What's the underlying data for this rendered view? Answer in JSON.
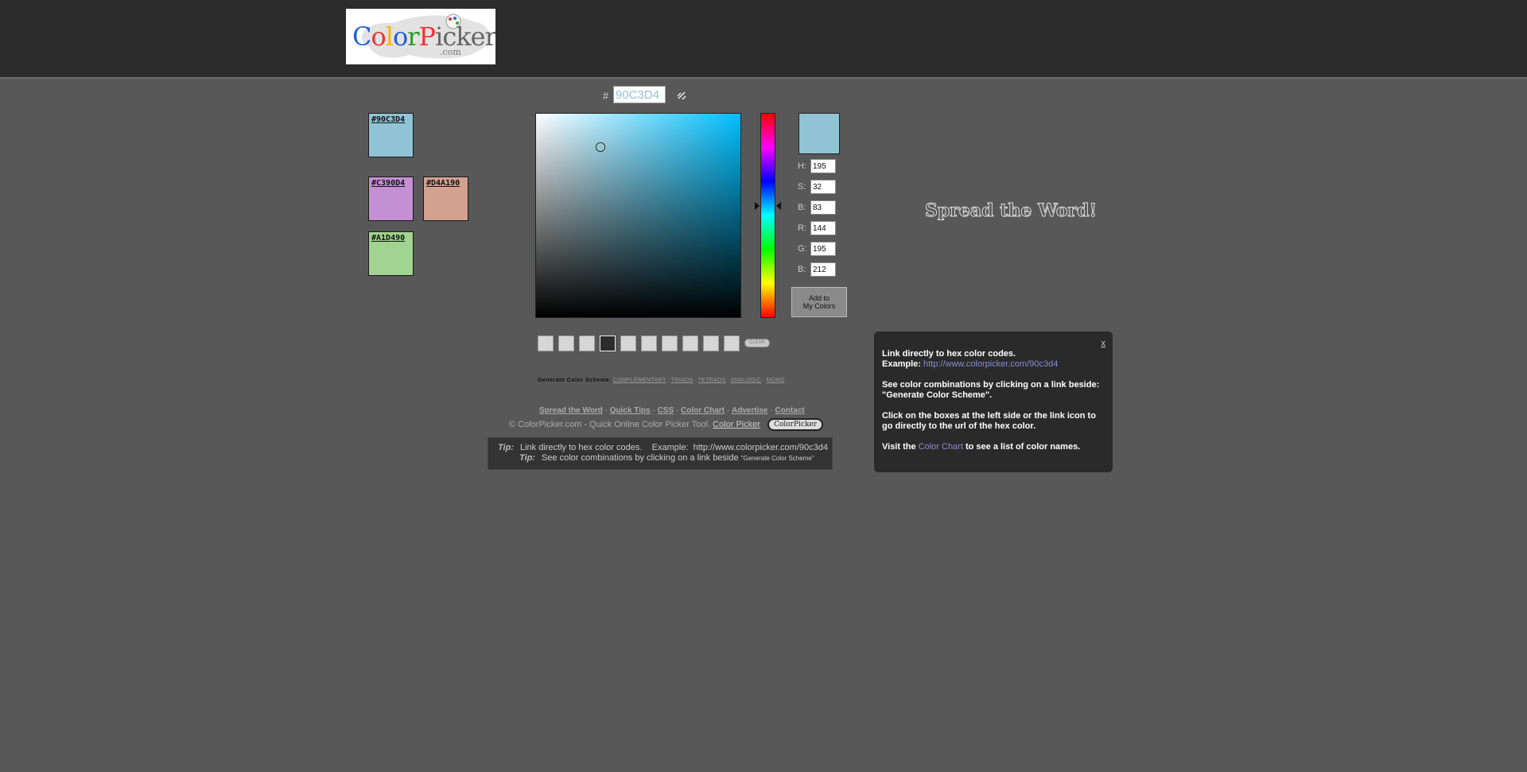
{
  "logo": {
    "text": "ColorPicker",
    "sub": ".com"
  },
  "hex_input": {
    "hash": "#",
    "value": "90C3D4"
  },
  "saved_colors": [
    {
      "hex": "#90C3D4",
      "color": "#90c3d4"
    },
    {
      "hex": "#C390D4",
      "color": "#c390d4"
    },
    {
      "hex": "#D4A190",
      "color": "#d4a190"
    },
    {
      "hex": "#A1D490",
      "color": "#a1d490"
    }
  ],
  "current_color": "#90c3d4",
  "fields": {
    "h": {
      "label": "H:",
      "value": "195"
    },
    "s": {
      "label": "S:",
      "value": "32"
    },
    "b": {
      "label": "B:",
      "value": "83"
    },
    "r": {
      "label": "R:",
      "value": "144"
    },
    "g": {
      "label": "G:",
      "value": "195"
    },
    "b2": {
      "label": "B:",
      "value": "212"
    }
  },
  "add_button": {
    "line1": "Add to",
    "line2": "My Colors"
  },
  "clear_label": "CLEAR",
  "scheme": {
    "label": "Generate Color Scheme:",
    "links": [
      "COMPLEMENTARY",
      "TRIADS",
      "TETRADS",
      "ANALOGIC",
      "MONO"
    ]
  },
  "footer": {
    "links": [
      "Spread the Word",
      "Quick Tips",
      "CSS",
      "Color Chart",
      "Advertise",
      "Contact"
    ],
    "copyright": "© ColorPicker.com - Quick Online Color Picker Tool.",
    "copyright_link": "Color Picker",
    "badge": "ColorPicker"
  },
  "tips": {
    "label": "Tip:",
    "tip1": "Link directly to hex color codes.    Example:  http://www.colorpicker.com/90c3d4",
    "tip2": "See color combinations by clicking on a link beside",
    "tip2_small": "\"Generate Color Scheme\""
  },
  "spread": "Spread the Word!",
  "info_panel": {
    "close": "x",
    "p1_title": "Link directly to hex color codes.",
    "p1_example_label": "Example:",
    "p1_example_link": "http://www.colorpicker.com/90c3d4",
    "p2": "See color combinations by clicking on a link beside: \"Generate Color Scheme\".",
    "p3": "Click on the boxes at the left side or the link icon to go directly to the url of the hex color.",
    "p4_pre": "Visit the",
    "p4_link": "Color Chart",
    "p4_post": "to see a list of color names."
  }
}
